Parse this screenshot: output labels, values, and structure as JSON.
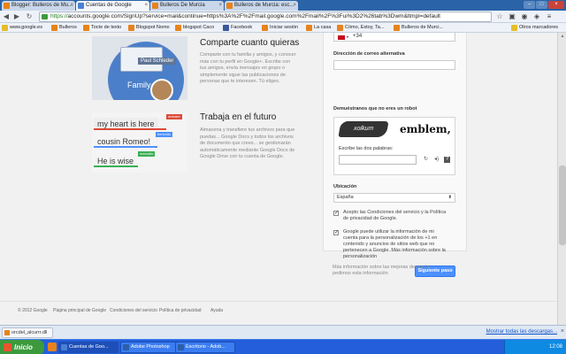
{
  "browser": {
    "tabs": [
      {
        "label": "Blogger: Bulleros de Mu..."
      },
      {
        "label": "Cuentas de Google"
      },
      {
        "label": "Bulleros De Murcia"
      },
      {
        "label": "Bulleros de Murcia: esc..."
      }
    ],
    "url_scheme": "https://",
    "url_rest": "accounts.google.com/SignUp?service=mail&continue=https%3A%2F%2Fmail.google.com%2Fmail%2F%3Fui%3D2%26tab%3Dwm&ltmpl=default",
    "bookmarks": [
      {
        "label": "www.google.es",
        "icon": "google-icon"
      },
      {
        "label": "Bulleros",
        "icon": "blogger-icon"
      },
      {
        "label": "Tocte de texto",
        "icon": "blogger-icon"
      },
      {
        "label": "Blogspot Nomo",
        "icon": "blogger-icon"
      },
      {
        "label": "blogspot Caco",
        "icon": "blogger-icon"
      },
      {
        "label": "Facebook",
        "icon": "facebook-icon"
      },
      {
        "label": "Iniciar sesión",
        "icon": "page-icon"
      },
      {
        "label": "La casa",
        "icon": "page-icon"
      },
      {
        "label": "Cómo, Estoy, Ta...",
        "icon": "blogger-icon"
      },
      {
        "label": "Bulleros de Murci...",
        "icon": "blogger-icon"
      }
    ],
    "other_bookmarks": "Otros marcadores"
  },
  "promos": [
    {
      "title": "Comparte cuanto quieras",
      "text": "Comparte con tu familia y amigos, y conocer más con tu perfil en Google+. Escribe con tus amigos, envía mensajes en grupo o simplemente sigue las publicaciones de personas que te interesen. Tú eliges.",
      "image": {
        "card_name": "Paul Schleder",
        "circle_label": "Family"
      }
    },
    {
      "title": "Trabaja en el futuro",
      "text": "Almacena y transfiere tus archivos para que puedas... Google Docs y todos los archivos de documento que crees... se gestionarán automáticamente mediante Google Docs de Google Drive con tu cuenta de Google.",
      "image": {
        "bubbles": [
          {
            "text": "my heart is here",
            "tag": "omhare",
            "color": "#dd4b39"
          },
          {
            "text": "cousin Romeo!",
            "tag": "benvolio",
            "color": "#4d90fe"
          },
          {
            "text": "He is wise",
            "tag": "mercutio",
            "color": "#3aaf55"
          }
        ]
      }
    }
  ],
  "form": {
    "phone_prefix": "+34",
    "alt_email_label": "Dirección de correo alternativa",
    "captcha_label": "Demuéstranos que no eres un robot",
    "captcha_word1": "xolkum",
    "captcha_word2": "emblem,",
    "captcha_input_label": "Escribe las dos palabras:",
    "location_label": "Ubicación",
    "location_value": "España",
    "terms_text": "Acepto las Condiciones del servicio y la Política de privacidad de Google.",
    "personalize_text": "Google puede utilizar la información de mi cuenta para la personalización de los +1 en contenido y anuncios de sitios web que no pertenecen a Google. Más información sobre la personalización",
    "next_button": "Siguiente paso",
    "below_note": "Más información sobre las mejoras de que te pedimos esta información"
  },
  "footer": {
    "copyright": "© 2012 Google",
    "links": [
      "Página principal de Google",
      "Condiciones del servicio",
      "Política de privacidad",
      "Ayuda"
    ]
  },
  "download_bar": {
    "file": "orcdel_alcurrr.dll",
    "show_all": "Mostrar todas las descargas..."
  },
  "taskbar": {
    "start": "Inicio",
    "tasks": [
      "Cuentas de Goo...",
      "Adobe Photoshop",
      "Escritorio - Adob..."
    ],
    "clock": "12:08"
  }
}
